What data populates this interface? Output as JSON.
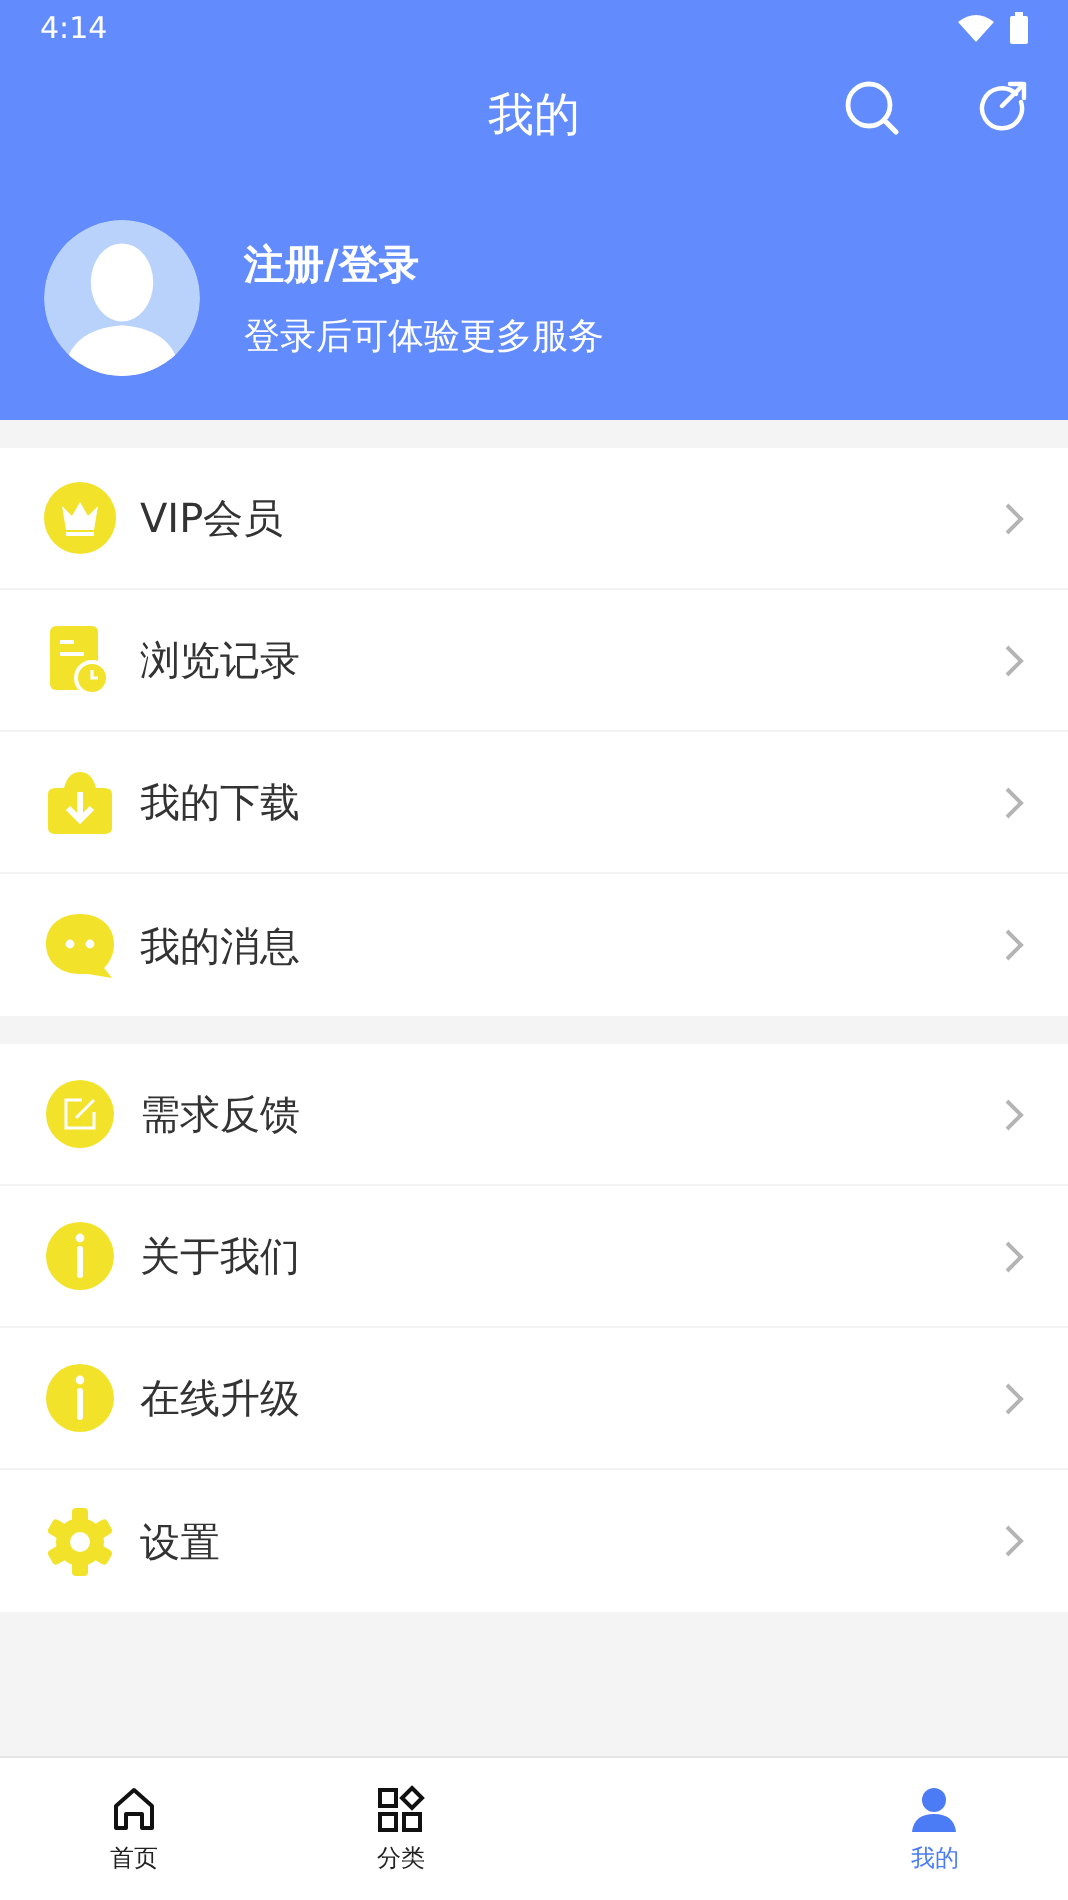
{
  "status_bar": {
    "time": "4:14"
  },
  "header": {
    "title": "我的"
  },
  "profile": {
    "name": "注册/登录",
    "subtitle": "登录后可体验更多服务"
  },
  "sections": [
    {
      "items": [
        {
          "kind": "crown",
          "label": "VIP会员"
        },
        {
          "kind": "history",
          "label": "浏览记录"
        },
        {
          "kind": "download",
          "label": "我的下载"
        },
        {
          "kind": "message",
          "label": "我的消息"
        }
      ]
    },
    {
      "items": [
        {
          "kind": "edit",
          "label": "需求反馈"
        },
        {
          "kind": "info",
          "label": "关于我们"
        },
        {
          "kind": "info",
          "label": "在线升级"
        },
        {
          "kind": "gear",
          "label": "设置"
        }
      ]
    }
  ],
  "bottom_nav": [
    {
      "kind": "home",
      "label": "首页",
      "selected": false
    },
    {
      "kind": "grid",
      "label": "分类",
      "selected": false
    },
    {
      "kind": "person",
      "label": "我的",
      "selected": true
    }
  ]
}
